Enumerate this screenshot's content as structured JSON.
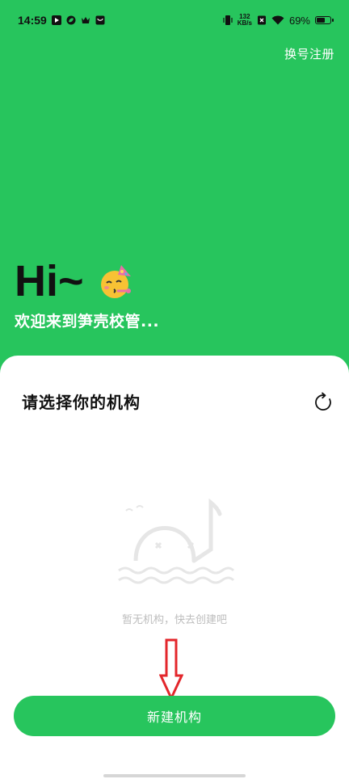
{
  "status_bar": {
    "time": "14:59",
    "net_speed_value": "132",
    "net_speed_unit": "KB/s",
    "battery_percent": "69%",
    "battery_level": 0.69
  },
  "header": {
    "switch_register": "换号注册"
  },
  "hero": {
    "greeting": "Hi~",
    "emoji": "party-face-icon",
    "subtitle": "欢迎来到笋壳校管..."
  },
  "sheet": {
    "title": "请选择你的机构",
    "empty_text": "暂无机构，快去创建吧",
    "create_button": "新建机构"
  },
  "colors": {
    "brand_green": "#27C55D",
    "annotation_red": "#E3262B"
  }
}
